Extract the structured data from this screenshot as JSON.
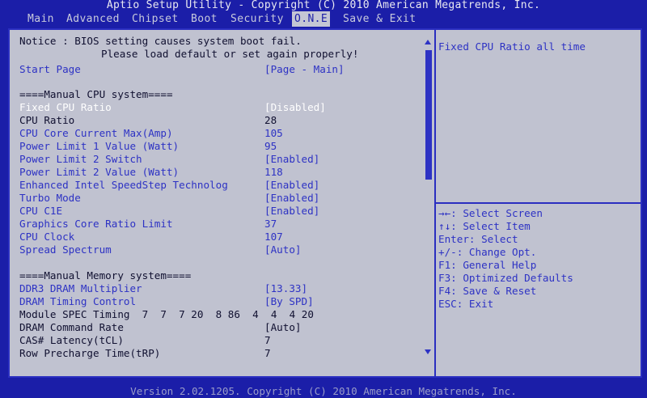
{
  "title": "Aptio Setup Utility - Copyright (C) 2010 American Megatrends, Inc.",
  "menu": [
    "Main",
    "Advanced",
    "Chipset",
    "Boot",
    "Security",
    "O.N.E",
    "Save & Exit"
  ],
  "active_menu": "O.N.E",
  "notice": {
    "line1": "Notice : BIOS setting causes system boot fail.",
    "line2": "Please load default or set again properly!"
  },
  "start_page": {
    "label": "Start Page",
    "value": "[Page - Main]"
  },
  "cpu_header": "====Manual CPU system====",
  "cpu_rows": [
    {
      "label": "Fixed CPU Ratio",
      "value": "[Disabled]"
    },
    {
      "label": "CPU Ratio",
      "value": "28"
    },
    {
      "label": "CPU Core Current Max(Amp)",
      "value": "105"
    },
    {
      "label": "Power Limit 1 Value (Watt)",
      "value": "95"
    },
    {
      "label": "Power Limit 2 Switch",
      "value": "[Enabled]"
    },
    {
      "label": "Power Limit 2 Value (Watt)",
      "value": "118"
    },
    {
      "label": "Enhanced Intel SpeedStep Technolog",
      "value": "[Enabled]"
    },
    {
      "label": "Turbo Mode",
      "value": "[Enabled]"
    },
    {
      "label": "CPU C1E",
      "value": "[Enabled]"
    },
    {
      "label": "Graphics Core Ratio Limit",
      "value": "37"
    },
    {
      "label": "CPU Clock",
      "value": "107"
    },
    {
      "label": "Spread Spectrum",
      "value": "[Auto]"
    }
  ],
  "mem_header": "====Manual Memory system====",
  "mem_rows": [
    {
      "label": "DDR3 DRAM Multiplier",
      "value": "[13.33]"
    },
    {
      "label": "DRAM Timing Control",
      "value": "[By SPD]"
    },
    {
      "label": "Module SPEC Timing  7  7  7 20  8 86  4  4  4 20",
      "value": ""
    },
    {
      "label": "DRAM Command Rate",
      "value": "[Auto]"
    },
    {
      "label": "CAS# Latency(tCL)",
      "value": "7"
    },
    {
      "label": "Row Precharge Time(tRP)",
      "value": "7"
    }
  ],
  "help": "Fixed CPU Ratio all time",
  "keys": [
    "→←: Select Screen",
    "↑↓: Select Item",
    "Enter: Select",
    "+/-: Change Opt.",
    "F1: General Help",
    "F3: Optimized Defaults",
    "F4: Save & Reset",
    "ESC: Exit"
  ],
  "footer": "Version 2.02.1205. Copyright (C) 2010 American Megatrends, Inc."
}
